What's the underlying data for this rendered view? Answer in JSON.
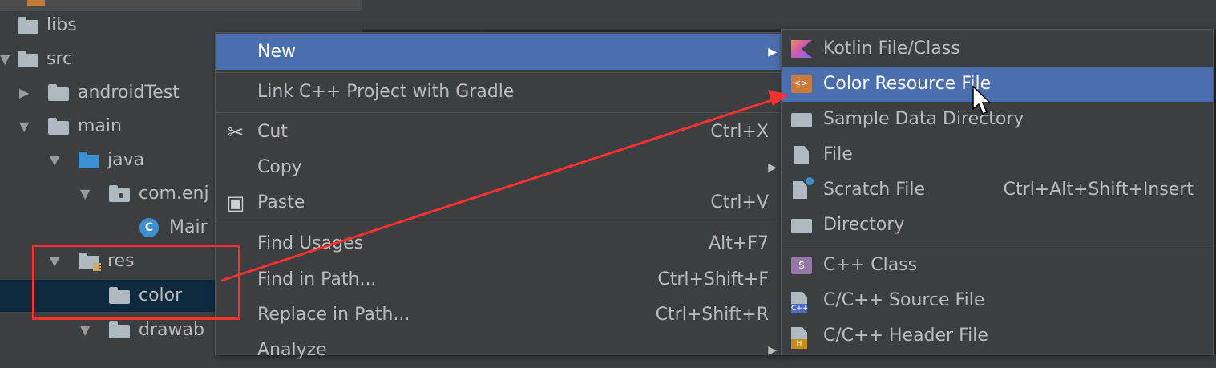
{
  "tree": {
    "items": [
      {
        "label": "libs"
      },
      {
        "label": "src"
      },
      {
        "label": "androidTest"
      },
      {
        "label": "main"
      },
      {
        "label": "java"
      },
      {
        "label": "com.enj"
      },
      {
        "label": "Mair"
      },
      {
        "label": "res"
      },
      {
        "label": "color"
      },
      {
        "label": "drawab"
      }
    ],
    "class_icon_letter": "C"
  },
  "context_menu": {
    "items": [
      {
        "label": "New",
        "shortcut": ""
      },
      {
        "label": "Link C++ Project with Gradle",
        "shortcut": ""
      },
      {
        "label": "Cut",
        "shortcut": "Ctrl+X",
        "icon": "scissors-icon"
      },
      {
        "label": "Copy",
        "shortcut": ""
      },
      {
        "label": "Paste",
        "shortcut": "Ctrl+V",
        "icon": "clipboard-icon"
      },
      {
        "label": "Find Usages",
        "shortcut": "Alt+F7"
      },
      {
        "label": "Find in Path...",
        "shortcut": "Ctrl+Shift+F"
      },
      {
        "label": "Replace in Path...",
        "shortcut": "Ctrl+Shift+R"
      },
      {
        "label": "Analyze",
        "shortcut": ""
      }
    ],
    "active_label": "New"
  },
  "new_submenu": {
    "items": [
      {
        "label": "Kotlin File/Class",
        "shortcut": "",
        "icon": "kotlin-icon"
      },
      {
        "label": "Color Resource File",
        "shortcut": "",
        "icon": "color-resource-icon"
      },
      {
        "label": "Sample Data Directory",
        "shortcut": "",
        "icon": "folder-icon"
      },
      {
        "label": "File",
        "shortcut": "",
        "icon": "file-icon"
      },
      {
        "label": "Scratch File",
        "shortcut": "Ctrl+Alt+Shift+Insert",
        "icon": "scratch-file-icon"
      },
      {
        "label": "Directory",
        "shortcut": "",
        "icon": "folder-icon"
      },
      {
        "label": "C++ Class",
        "shortcut": "",
        "icon": "cpp-class-icon"
      },
      {
        "label": "C/C++ Source File",
        "shortcut": "",
        "icon": "cpp-source-icon"
      },
      {
        "label": "C/C++ Header File",
        "shortcut": "",
        "icon": "cpp-header-icon"
      }
    ],
    "active_label": "Color Resource File",
    "icon_text": {
      "cpp_class": "S",
      "source_badge": "C++",
      "header_badge": "H"
    }
  },
  "colors": {
    "accent": "#4b6eaf",
    "annotation": "#ff3030",
    "selected_row": "#0d293e",
    "panel_bg": "#3c3f41"
  }
}
